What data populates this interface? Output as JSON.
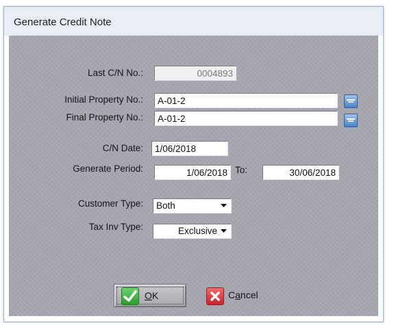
{
  "window": {
    "title": "Generate Credit Note"
  },
  "form": {
    "last_cn_label": "Last C/N No.:",
    "last_cn_value": "0004893",
    "initial_property_label": "Initial Property No.:",
    "initial_property_value": "A-01-2",
    "final_property_label": "Final Property No.:",
    "final_property_value": "A-01-2",
    "cn_date_label": "C/N Date:",
    "cn_date_value": "1/06/2018",
    "generate_period_label": "Generate Period:",
    "period_from_value": "1/06/2018",
    "to_label": "To:",
    "period_to_value": "30/06/2018",
    "customer_type_label": "Customer Type:",
    "customer_type_value": "Both",
    "tax_inv_type_label": "Tax Inv Type:",
    "tax_inv_type_value": "Exclusive"
  },
  "buttons": {
    "ok_mnemonic": "O",
    "ok_rest": "K",
    "cancel_prefix": "C",
    "cancel_mnemonic": "a",
    "cancel_rest": "ncel"
  },
  "icons": {
    "lookup_button_icon": "lookup-icon",
    "ok_icon": "checkmark-icon",
    "cancel_icon": "close-x-icon",
    "dropdown_icon": "chevron-down-icon"
  },
  "colors": {
    "dialog_background": "#a6a6b0",
    "titlebar": "#e9eef5",
    "ok_icon_green": "#3aa63a",
    "cancel_icon_red": "#d6343a",
    "lookup_blue": "#4a84c4"
  }
}
